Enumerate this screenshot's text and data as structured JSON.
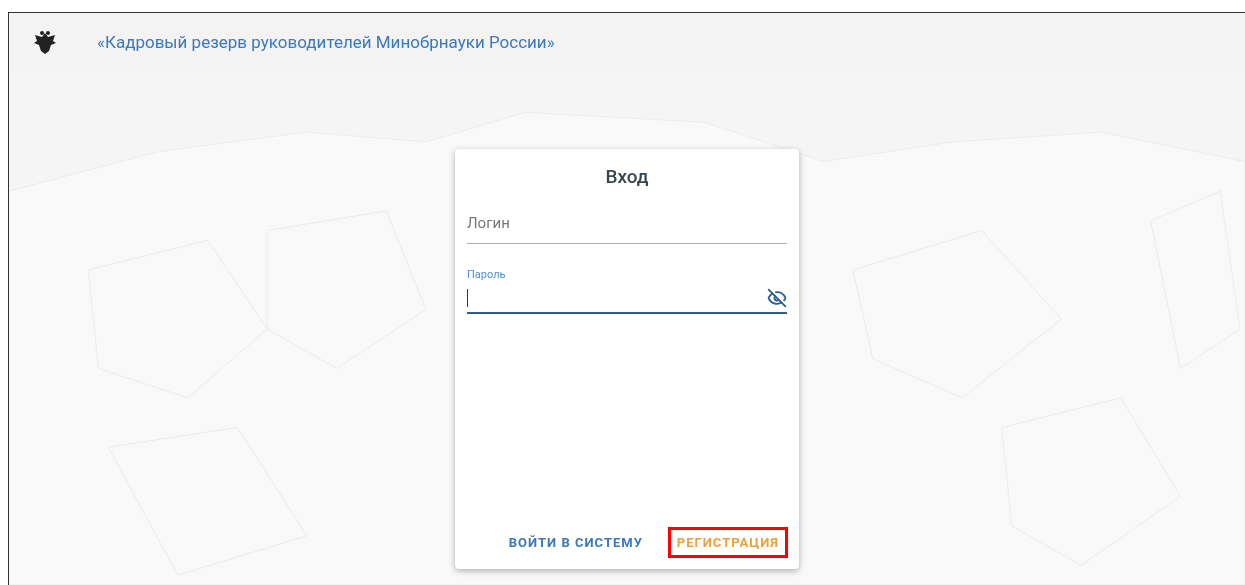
{
  "header": {
    "title": "«Кадровый резерв руководителей Минобрнауки России»"
  },
  "login_card": {
    "title": "Вход",
    "fields": [
      {
        "kind": "plain",
        "placeholder": "Логин",
        "focused": false
      },
      {
        "kind": "password",
        "label": "Пароль",
        "focused": true
      }
    ],
    "buttons": [
      {
        "label": "ВОЙТИ В СИСТЕМУ",
        "kind": "primary",
        "highlighted": false
      },
      {
        "label": "РЕГИСТРАЦИЯ",
        "kind": "secondary",
        "highlighted": true
      }
    ]
  }
}
